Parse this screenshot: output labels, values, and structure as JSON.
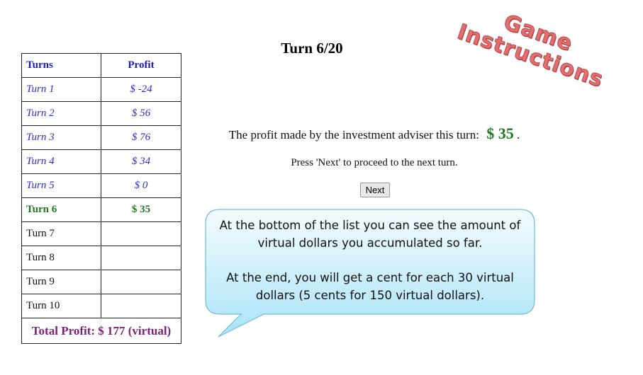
{
  "header": {
    "turn_label": "Turn 6/20"
  },
  "table": {
    "col_turns": "Turns",
    "col_profit": "Profit",
    "rows": [
      {
        "turn": "Turn 1",
        "profit": "$ -24"
      },
      {
        "turn": "Turn 2",
        "profit": "$ 56"
      },
      {
        "turn": "Turn 3",
        "profit": "$ 76"
      },
      {
        "turn": "Turn 4",
        "profit": "$ 34"
      },
      {
        "turn": "Turn 5",
        "profit": "$ 0"
      },
      {
        "turn": "Turn 6",
        "profit": "$ 35"
      },
      {
        "turn": "Turn 7",
        "profit": ""
      },
      {
        "turn": "Turn 8",
        "profit": ""
      },
      {
        "turn": "Turn 9",
        "profit": ""
      },
      {
        "turn": "Turn 10",
        "profit": ""
      }
    ],
    "total": "Total Profit: $ 177 (virtual)"
  },
  "main": {
    "profit_text": "The profit made by the investment adviser this turn:",
    "profit_value": "$ 35",
    "profit_suffix": ".",
    "press_text": "Press 'Next' to proceed to the next turn.",
    "next_label": "Next"
  },
  "callout": {
    "line1": "At the bottom of the list you can see the amount of virtual dollars you accumulated so far.",
    "line2": "At the end, you will get a cent for each 30 virtual dollars (5 cents for 150 virtual dollars)."
  },
  "instructions": {
    "line1": "Game",
    "line2": "Instructions"
  },
  "colors": {
    "past_turn": "#2a2ad8",
    "current_turn": "#1f7a1f",
    "total": "#7a1f7a",
    "callout_fill": "#c9eefb",
    "instructions": "#e07070"
  }
}
